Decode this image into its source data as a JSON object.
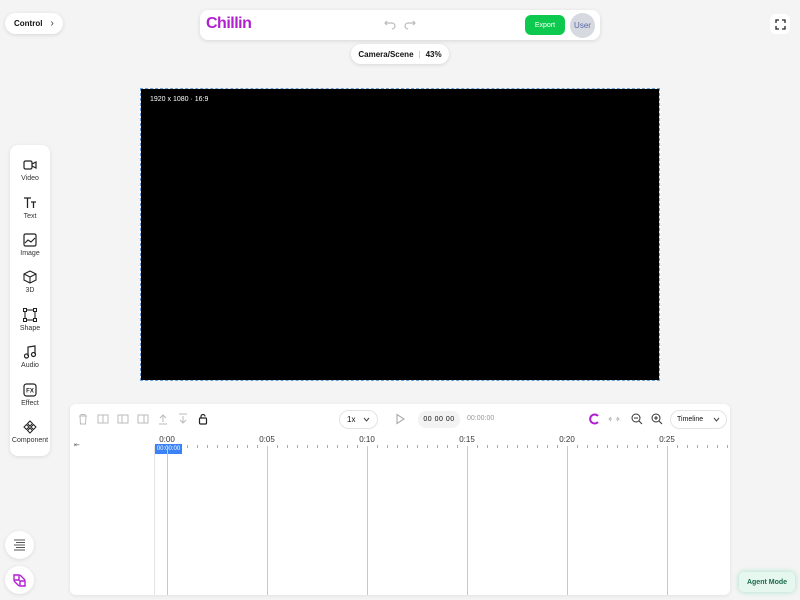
{
  "control": {
    "label": "Control"
  },
  "topbar": {
    "logo": "Chillin",
    "export_label": "Export",
    "user_label": "User"
  },
  "scene": {
    "label": "Camera/Scene",
    "zoom": "43%"
  },
  "canvas": {
    "info": "1920 x 1080 · 16:9"
  },
  "tools": [
    {
      "label": "Video",
      "icon": "video-icon"
    },
    {
      "label": "Text",
      "icon": "text-icon"
    },
    {
      "label": "Image",
      "icon": "image-icon"
    },
    {
      "label": "3D",
      "icon": "cube-icon"
    },
    {
      "label": "Shape",
      "icon": "shape-icon"
    },
    {
      "label": "Audio",
      "icon": "audio-icon"
    },
    {
      "label": "Effect",
      "icon": "effect-icon"
    },
    {
      "label": "Component",
      "icon": "component-icon"
    }
  ],
  "timeline": {
    "speed": "1x",
    "current_time": "00 00 00",
    "total_time": "00:00:00",
    "view": "Timeline",
    "playhead": "00:00:00",
    "ticks": [
      "0:00",
      "0:05",
      "0:10",
      "0:15",
      "0:20",
      "0:25"
    ]
  },
  "agent_mode": {
    "label": "Agent Mode"
  },
  "colors": {
    "brand": "#b01fd0",
    "export": "#0dca4e",
    "playhead": "#3b82f6"
  }
}
